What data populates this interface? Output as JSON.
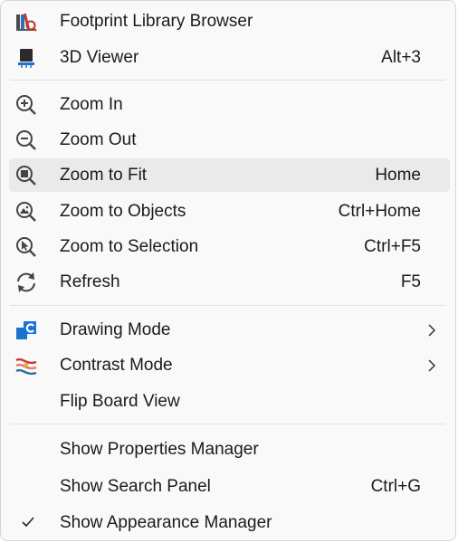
{
  "menu": {
    "items": [
      {
        "label": "Footprint Library Browser",
        "shortcut": "",
        "icon": "library-browser-icon"
      },
      {
        "label": "3D Viewer",
        "shortcut": "Alt+3",
        "icon": "3d-viewer-icon"
      },
      {
        "label": "Zoom In",
        "shortcut": "",
        "icon": "zoom-in-icon"
      },
      {
        "label": "Zoom Out",
        "shortcut": "",
        "icon": "zoom-out-icon"
      },
      {
        "label": "Zoom to Fit",
        "shortcut": "Home",
        "icon": "zoom-to-fit-icon"
      },
      {
        "label": "Zoom to Objects",
        "shortcut": "Ctrl+Home",
        "icon": "zoom-to-objects-icon"
      },
      {
        "label": "Zoom to Selection",
        "shortcut": "Ctrl+F5",
        "icon": "zoom-to-selection-icon"
      },
      {
        "label": "Refresh",
        "shortcut": "F5",
        "icon": "refresh-icon"
      },
      {
        "label": "Drawing Mode",
        "shortcut": "",
        "icon": "drawing-mode-icon",
        "submenu": true
      },
      {
        "label": "Contrast Mode",
        "shortcut": "",
        "icon": "contrast-mode-icon",
        "submenu": true
      },
      {
        "label": "Flip Board View",
        "shortcut": ""
      },
      {
        "label": "Show Properties Manager",
        "shortcut": ""
      },
      {
        "label": "Show Search Panel",
        "shortcut": "Ctrl+G"
      },
      {
        "label": "Show Appearance Manager",
        "shortcut": "",
        "checked": true
      }
    ],
    "highlighted_item": "Zoom to Fit",
    "colors": {
      "background": "#f9f9f9",
      "highlight": "#eaeaea",
      "separator": "#e0e0e0",
      "text": "#1b1b1b",
      "accent_blue": "#1a73d2",
      "accent_red": "#d0342c"
    }
  }
}
